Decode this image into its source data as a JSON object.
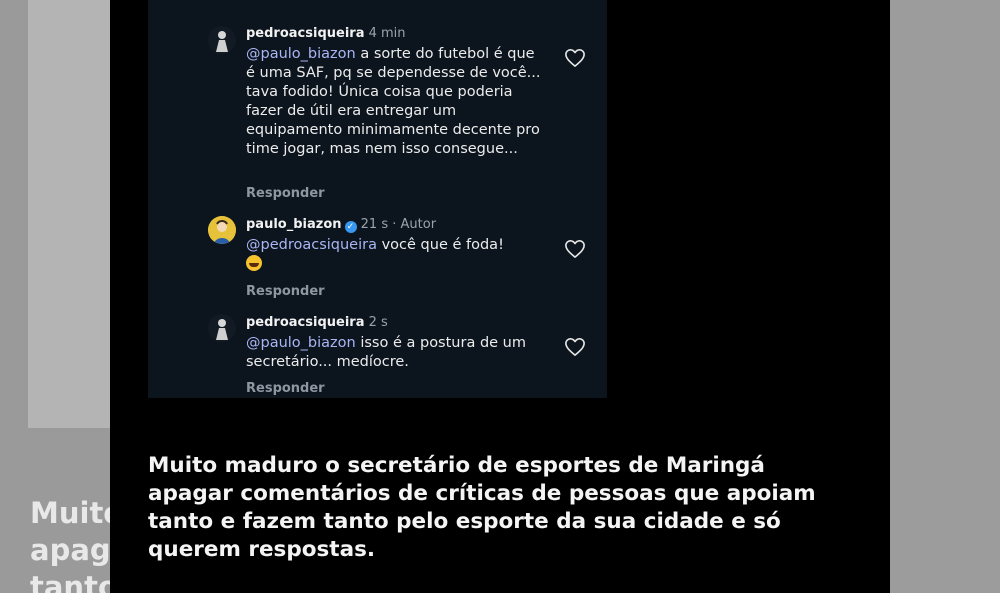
{
  "comments": [
    {
      "username": "pedroacsiqueira",
      "time": "4 min",
      "author_tag": "",
      "mention": "@paulo_biazon",
      "text": " a sorte do futebol é que é uma SAF, pq se dependesse de você... tava fodido! Única coisa que poderia fazer de útil era entregar um equipamento minimamente decente pro time jogar, mas nem isso consegue...",
      "reply_label": "Responder",
      "verified": false
    },
    {
      "username": "paulo_biazon",
      "time": "21 s",
      "author_tag": "Autor",
      "mention": "@pedroacsiqueira",
      "text": " você que é foda!",
      "reply_label": "Responder",
      "verified": true
    },
    {
      "username": "pedroacsiqueira",
      "time": "2 s",
      "author_tag": "",
      "mention": "@paulo_biazon",
      "text": " isso é a postura de um secretário... medíocre.",
      "reply_label": "Responder",
      "verified": false
    }
  ],
  "caption": "Muito maduro o secretário de esportes de Maringá apagar comentários de críticas de pessoas que apoiam tanto e fazem tanto pelo esporte da sua cidade e só querem respostas.",
  "background_ghost_text": "Muito maduro o secretário\napagar comentários\ntanto e fazem",
  "icons": {
    "like": "heart-outline-icon",
    "verified": "verified-badge-icon",
    "emoji": "laughing-emoji-icon"
  },
  "colors": {
    "panel_bg": "#0c141e",
    "mention": "#a9b6f3",
    "verified": "#3897f0",
    "page_bg": "#000000"
  }
}
